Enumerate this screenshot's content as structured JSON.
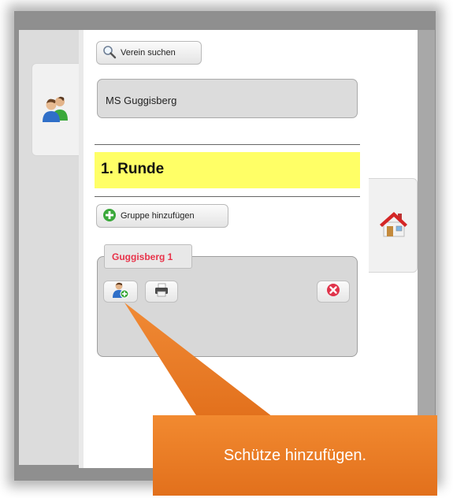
{
  "toolbar": {
    "search_label": "Verein suchen",
    "add_group_label": "Gruppe hinzufügen"
  },
  "club": {
    "name": "MS Guggisberg"
  },
  "round": {
    "title": "1. Runde"
  },
  "group": {
    "name": "Guggisberg 1"
  },
  "callout": {
    "text": "Schütze hinzufügen."
  },
  "icons": {
    "users": "users-icon",
    "home": "home-icon",
    "search": "search-icon",
    "add_circle": "add-circle-icon",
    "add_user": "add-user-icon",
    "print": "print-icon",
    "delete": "delete-icon"
  },
  "colors": {
    "round_highlight": "#ffff66",
    "group_name": "#e8334a",
    "callout": "#ee7b25",
    "delete": "#e0334a",
    "add": "#3aa83a"
  }
}
